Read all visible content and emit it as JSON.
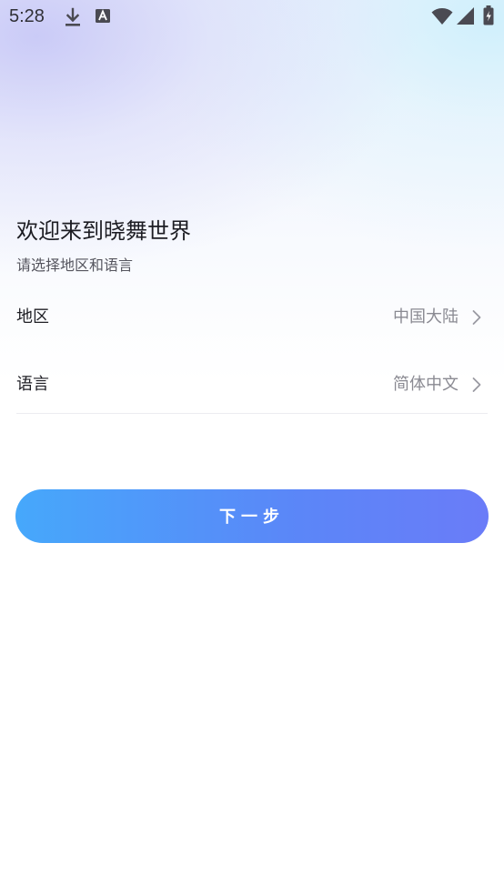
{
  "status_bar": {
    "time": "5:28",
    "icons": [
      "download-icon",
      "a-letter-icon",
      "wifi-icon",
      "signal-icon",
      "battery-icon"
    ]
  },
  "welcome": {
    "title": "欢迎来到晓舞世界",
    "subtitle": "请选择地区和语言"
  },
  "settings": {
    "region": {
      "label": "地区",
      "value": "中国大陆"
    },
    "language": {
      "label": "语言",
      "value": "简体中文"
    }
  },
  "next_button": {
    "label": "下一步"
  },
  "colors": {
    "button_gradient_start": "#46a8fb",
    "button_gradient_end": "#6a7cf8",
    "text_primary": "#1e1e24",
    "text_secondary": "#8a8a92",
    "divider": "#ececf0"
  }
}
